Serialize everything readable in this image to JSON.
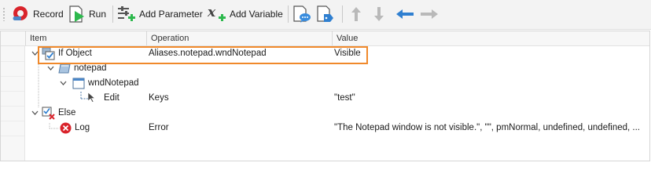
{
  "toolbar": {
    "record": "Record",
    "run": "Run",
    "add_parameter": "Add Parameter",
    "add_variable": "Add Variable"
  },
  "columns": {
    "item": "Item",
    "operation": "Operation",
    "value": "Value"
  },
  "rows": [
    {
      "item": "If Object",
      "operation": "Aliases.notepad.wndNotepad",
      "value": "Visible"
    },
    {
      "item": "notepad",
      "operation": "",
      "value": ""
    },
    {
      "item": "wndNotepad",
      "operation": "",
      "value": ""
    },
    {
      "item": "Edit",
      "operation": "Keys",
      "value": "\"test\""
    },
    {
      "item": "Else",
      "operation": "",
      "value": ""
    },
    {
      "item": "Log",
      "operation": "Error",
      "value": "\"The Notepad window is not visible.\", \"\", pmNormal, undefined, undefined, ..."
    }
  ],
  "colors": {
    "highlight": "#f0892b",
    "record_red": "#d9232b",
    "run_green": "#2db84d",
    "arrow_blue": "#2f7fd0"
  }
}
